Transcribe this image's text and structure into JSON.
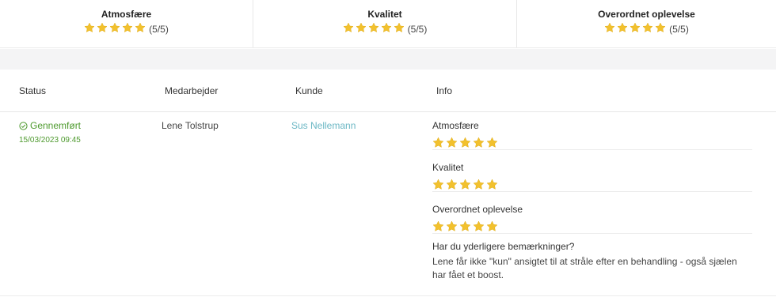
{
  "summary": [
    {
      "title": "Atmosfære",
      "rating": 5,
      "score_label": "(5/5)"
    },
    {
      "title": "Kvalitet",
      "rating": 5,
      "score_label": "(5/5)"
    },
    {
      "title": "Overordnet oplevelse",
      "rating": 5,
      "score_label": "(5/5)"
    }
  ],
  "table": {
    "headers": {
      "status": "Status",
      "employee": "Medarbejder",
      "customer": "Kunde",
      "info": "Info"
    },
    "row": {
      "status": "Gennemført",
      "date": "15/03/2023 09:45",
      "employee": "Lene Tolstrup",
      "customer": "Sus Nellemann",
      "ratings": [
        {
          "label": "Atmosfære",
          "rating": 5
        },
        {
          "label": "Kvalitet",
          "rating": 5
        },
        {
          "label": "Overordnet oplevelse",
          "rating": 5
        }
      ],
      "comment_question": "Har du yderligere bemærkninger?",
      "comment_answer": "Lene får ikke \"kun\" ansigtet til at stråle efter en behandling - også sjælen har fået et boost."
    }
  },
  "colors": {
    "star": "#f2c12e",
    "status_green": "#4e9a2e",
    "link": "#6bb7c4"
  },
  "icons": {
    "star": "star-icon",
    "status": "check-circle-icon"
  }
}
